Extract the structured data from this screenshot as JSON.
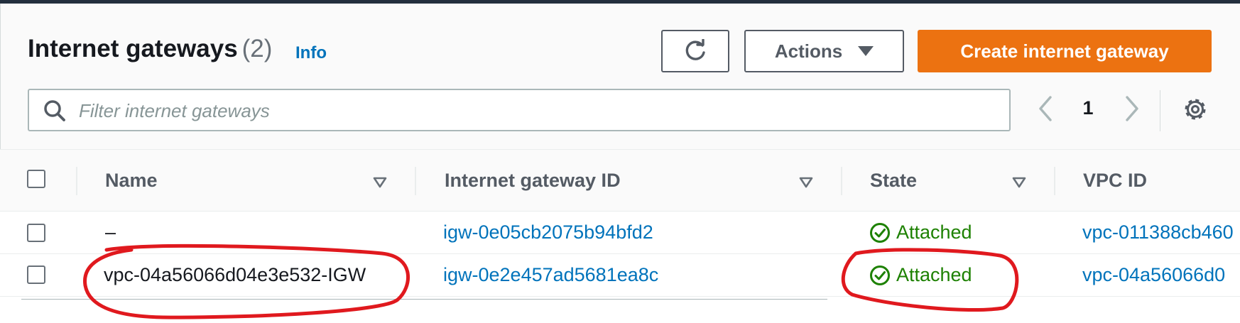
{
  "header": {
    "title": "Internet gateways",
    "count": "(2)",
    "info_link": "Info"
  },
  "toolbar": {
    "refresh_icon": "refresh-icon",
    "actions_label": "Actions",
    "create_label": "Create internet gateway"
  },
  "search": {
    "placeholder": "Filter internet gateways",
    "value": ""
  },
  "pagination": {
    "current_page": "1"
  },
  "table": {
    "columns": [
      "Name",
      "Internet gateway ID",
      "State",
      "VPC ID"
    ],
    "rows": [
      {
        "name": "–",
        "gateway_id": "igw-0e05cb2075b94bfd2",
        "state": "Attached",
        "vpc_id": "vpc-011388cb460"
      },
      {
        "name": "vpc-04a56066d04e3e532-IGW",
        "gateway_id": "igw-0e2e457ad5681ea8c",
        "state": "Attached",
        "vpc_id": "vpc-04a56066d0"
      }
    ]
  },
  "colors": {
    "primary": "#ec7211",
    "link": "#0073bb",
    "success": "#1d8102",
    "annotation": "#e0191e"
  }
}
